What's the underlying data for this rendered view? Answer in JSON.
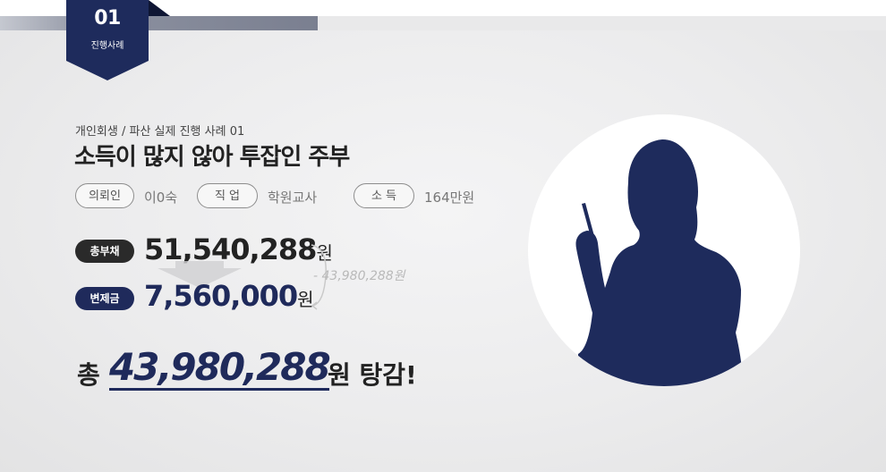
{
  "badge": {
    "number": "01",
    "label": "진행사례"
  },
  "case": {
    "subtitle": "개인회생 / 파산 실제 진행 사례 01",
    "title": "소득이 많지 않아 투잡인 주부"
  },
  "info": [
    {
      "label": "의뢰인",
      "value": "이0숙"
    },
    {
      "label": "직 업",
      "value": "학원교사"
    },
    {
      "label": "소 득",
      "value": "164만원"
    }
  ],
  "debt": {
    "label": "총부채",
    "amount": "51,540,288",
    "unit": "원"
  },
  "repay": {
    "label": "변제금",
    "amount": "7,560,000",
    "unit": "원"
  },
  "difference": "- 43,980,288원",
  "total": {
    "prefix": "총",
    "amount": "43,980,288",
    "suffix": "원 탕감!"
  },
  "colors": {
    "navy": "#1f2a5b",
    "dark": "#222222",
    "badge": "#1e2b5c"
  },
  "icons": {
    "silhouette": "person-silhouette-icon",
    "arrow": "down-arrow-icon"
  }
}
